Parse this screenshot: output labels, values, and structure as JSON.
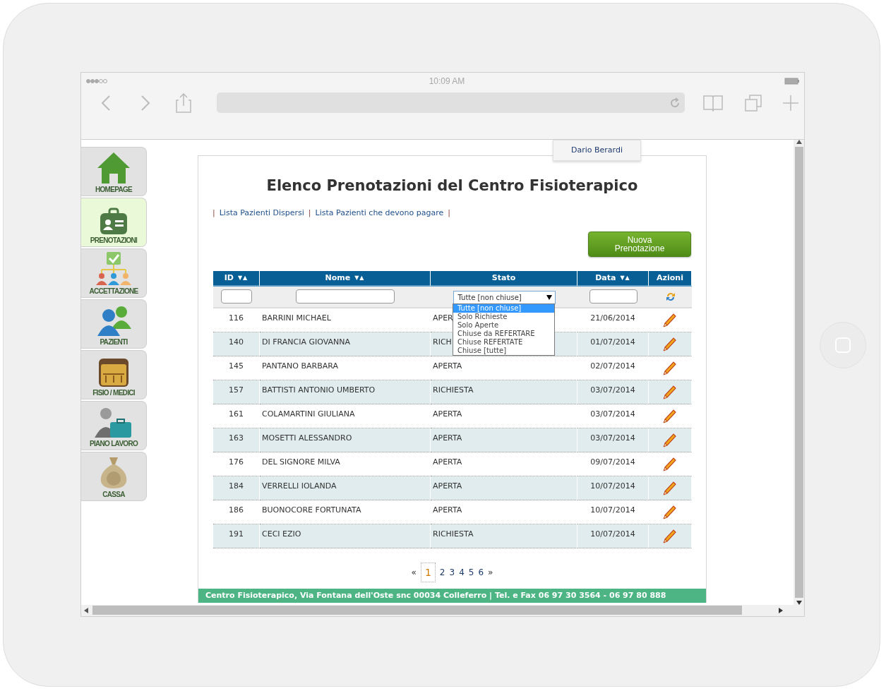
{
  "browser": {
    "time": "10:09 AM"
  },
  "sidebar": {
    "items": [
      {
        "label": "HOMEPAGE",
        "selected": false
      },
      {
        "label": "PRENOTAZIONI",
        "selected": true
      },
      {
        "label": "ACCETTAZIONE",
        "selected": false
      },
      {
        "label": "PAZIENTI",
        "selected": false
      },
      {
        "label": "FISIO / MEDICI",
        "selected": false
      },
      {
        "label": "PIANO LAVORO",
        "selected": false
      },
      {
        "label": "CASSA",
        "selected": false
      }
    ]
  },
  "user": {
    "name": "Dario Berardi"
  },
  "page": {
    "title": "Elenco Prenotazioni del Centro Fisioterapico",
    "separator": "|",
    "links": [
      "Lista Pazienti Dispersi",
      "Lista Pazienti che devono pagare"
    ],
    "new_button": "Nuova Prenotazione"
  },
  "table": {
    "columns": [
      {
        "label": "ID",
        "sort": "▼▲"
      },
      {
        "label": "Nome",
        "sort": "▼▲"
      },
      {
        "label": "Stato"
      },
      {
        "label": "Data",
        "sort": "▼▲"
      },
      {
        "label": "Azioni"
      }
    ],
    "stato_filter": {
      "value": "Tutte [non chiuse]",
      "expanded": true,
      "options": [
        {
          "label": "Tutte [non chiuse]",
          "selected": true
        },
        {
          "label": "Solo Richieste",
          "selected": false
        },
        {
          "label": "Solo Aperte",
          "selected": false
        },
        {
          "label": "Chiuse da REFERTARE",
          "selected": false
        },
        {
          "label": "Chiuse REFERTATE",
          "selected": false
        },
        {
          "label": "Chiuse [tutte]",
          "selected": false
        }
      ]
    },
    "rows": [
      {
        "id": "116",
        "nome": "BARRINI MICHAEL",
        "stato": "APER",
        "data": "21/06/2014"
      },
      {
        "id": "140",
        "nome": "DI FRANCIA GIOVANNA",
        "stato": "RICH",
        "data": "01/07/2014"
      },
      {
        "id": "145",
        "nome": "PANTANO BARBARA",
        "stato": "APERTA",
        "data": "02/07/2014"
      },
      {
        "id": "157",
        "nome": "BATTISTI ANTONIO UMBERTO",
        "stato": "RICHIESTA",
        "data": "03/07/2014"
      },
      {
        "id": "161",
        "nome": "COLAMARTINI GIULIANA",
        "stato": "APERTA",
        "data": "03/07/2014"
      },
      {
        "id": "163",
        "nome": "MOSETTI ALESSANDRO",
        "stato": "APERTA",
        "data": "03/07/2014"
      },
      {
        "id": "176",
        "nome": "DEL SIGNORE MILVA",
        "stato": "APERTA",
        "data": "09/07/2014"
      },
      {
        "id": "184",
        "nome": "VERRELLI IOLANDA",
        "stato": "APERTA",
        "data": "10/07/2014"
      },
      {
        "id": "186",
        "nome": "BUONOCORE FORTUNATA",
        "stato": "APERTA",
        "data": "10/07/2014"
      },
      {
        "id": "191",
        "nome": "CECI EZIO",
        "stato": "RICHIESTA",
        "data": "10/07/2014"
      }
    ]
  },
  "pagination": {
    "prev": "«",
    "pages": [
      {
        "label": "1",
        "selected": true
      },
      {
        "label": "2",
        "selected": false
      },
      {
        "label": "3",
        "selected": false
      },
      {
        "label": "4",
        "selected": false
      },
      {
        "label": "5",
        "selected": false
      },
      {
        "label": "6",
        "selected": false
      }
    ],
    "next": "»"
  },
  "footer": "Centro Fisioterapico, Via Fontana dell'Oste snc 00034 Colleferro | Tel. e Fax 06 97 30 3564 - 06 97 80 888"
}
